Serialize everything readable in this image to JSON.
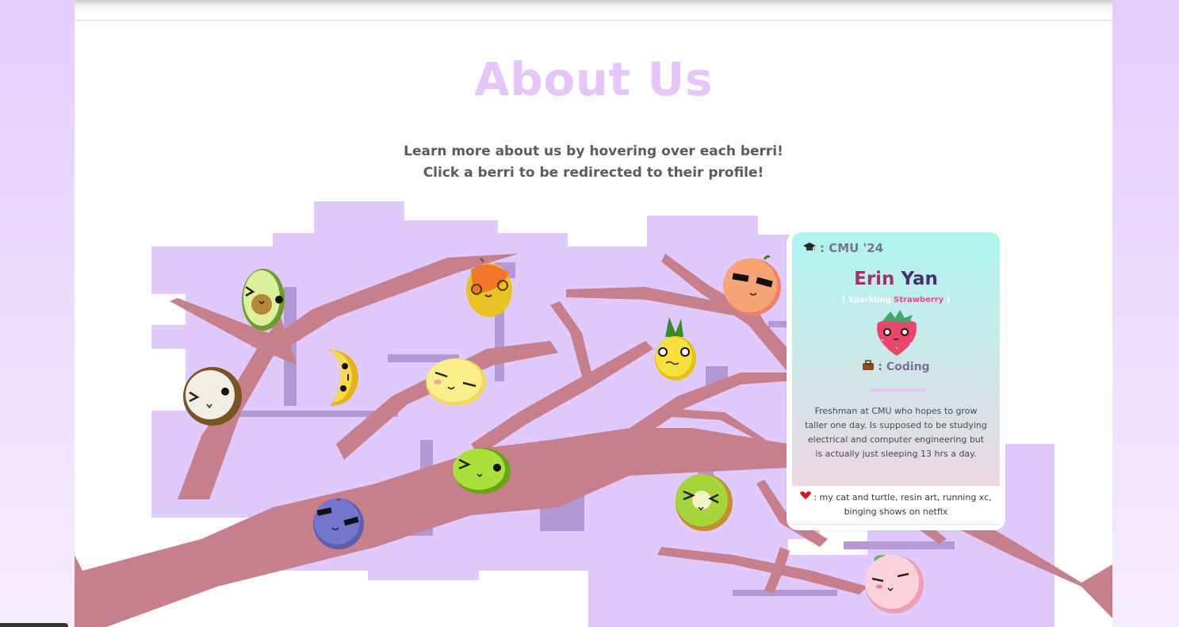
{
  "page": {
    "title": "About Us",
    "subtitle_line1": "Learn more about us by hovering over each berri!",
    "subtitle_line2": "Click a berri to be redirected to their profile!"
  },
  "colors": {
    "title": "#e4c6fb",
    "tree_bg": "#e0cafd",
    "tree_shadow": "#b497d5",
    "branch": "#c77f8c",
    "card_gradient_top": "#aef4ef",
    "card_gradient_bottom": "#ecd6e2"
  },
  "fruits": [
    "avocado",
    "mango",
    "orange",
    "banana",
    "coconut",
    "lemon",
    "pineapple",
    "lime",
    "blueberry",
    "kiwi",
    "peach"
  ],
  "card": {
    "school_icon": "graduation-cap-icon",
    "school": ": CMU '24",
    "first_name": "Erin",
    "last_name": "Yan",
    "flavor_open": "( Sparkling ",
    "flavor_fruit": "Strawberry",
    "flavor_close": " )",
    "hobby_icon": "briefcase-icon",
    "hobby": ": Coding",
    "bio": "Freshman at CMU who hopes to grow taller one day. Is supposed to be studying electrical and computer engineering but is actually just sleeping 13 hrs a day.",
    "likes_icon": "heart-icon",
    "likes": ": my cat and turtle, resin art, running xc, binging shows on netfix"
  }
}
